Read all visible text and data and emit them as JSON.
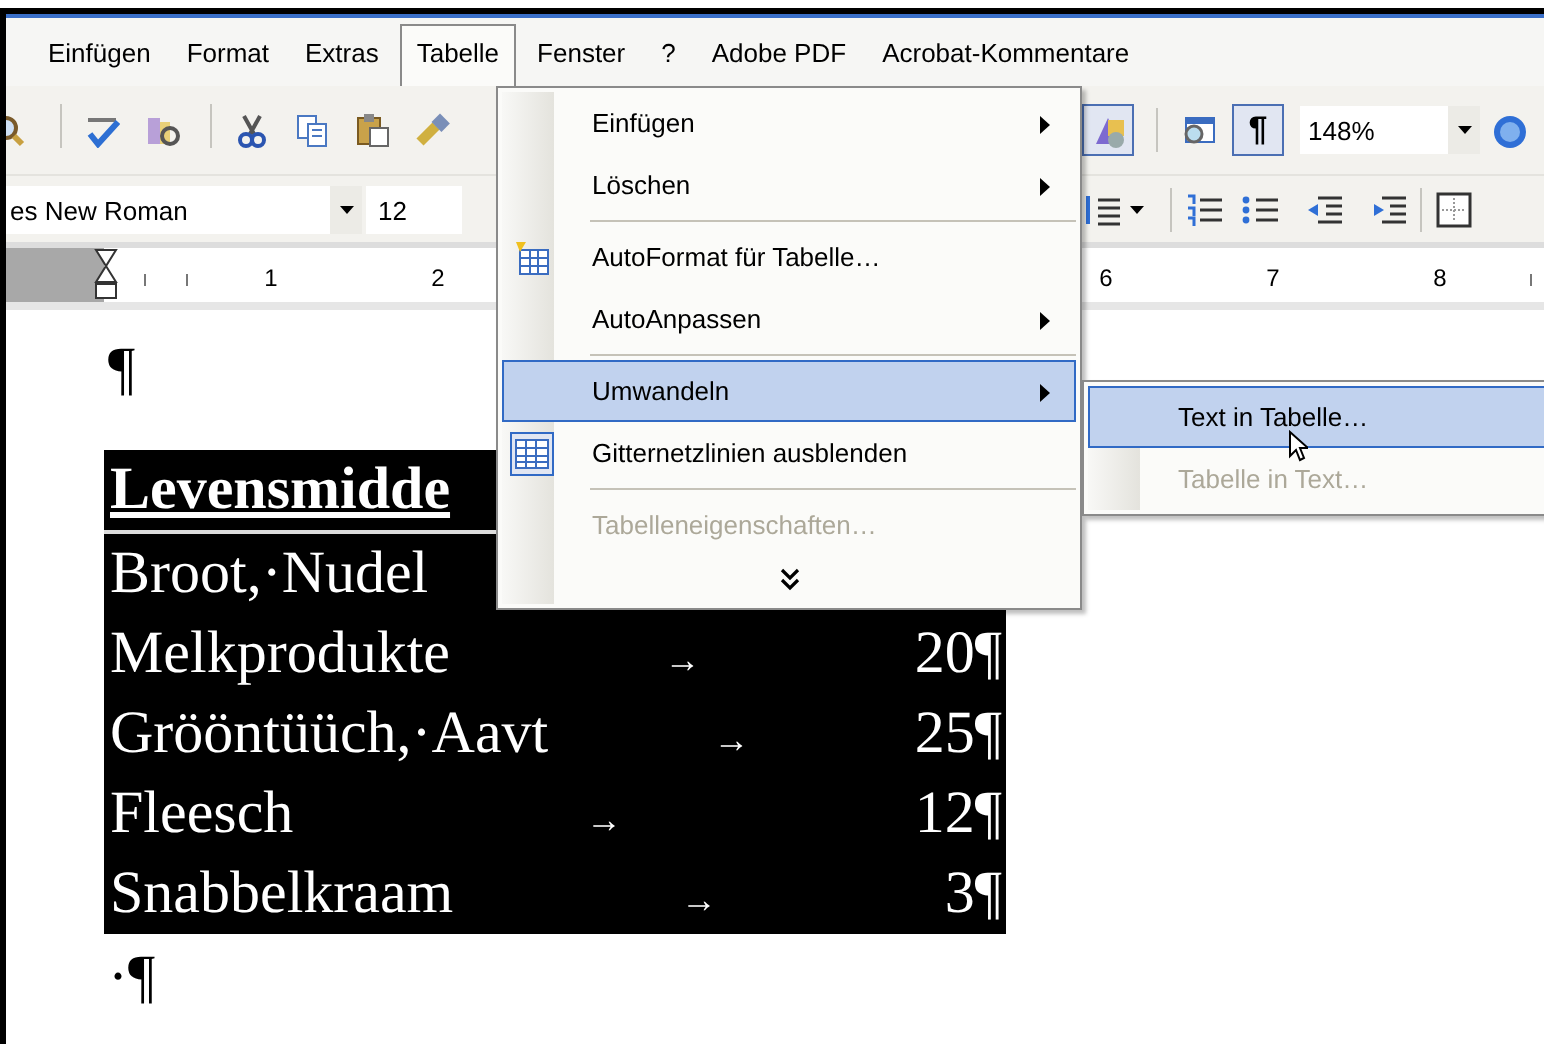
{
  "menubar": {
    "items": [
      {
        "label": "Einfügen",
        "selected": false
      },
      {
        "label": "Format",
        "selected": false
      },
      {
        "label": "Extras",
        "selected": false
      },
      {
        "label": "Tabelle",
        "selected": true
      },
      {
        "label": "Fenster",
        "selected": false
      },
      {
        "label": "?",
        "selected": false
      },
      {
        "label": "Adobe PDF",
        "selected": false
      },
      {
        "label": "Acrobat-Kommentare",
        "selected": false
      }
    ]
  },
  "standard_toolbar": {
    "left_buttons": [
      {
        "pressed": false
      },
      {
        "pressed": false
      },
      {
        "pressed": false
      },
      {
        "pressed": false
      },
      {
        "pressed": false
      },
      {
        "pressed": false
      },
      {
        "pressed": false
      }
    ],
    "right_buttons": [
      {
        "pressed": true
      },
      {
        "pressed": false
      },
      {
        "label": "¶",
        "pressed": true
      }
    ],
    "zoom": "148%"
  },
  "formatting_toolbar": {
    "font": "es New Roman",
    "size": "12"
  },
  "ruler": {
    "left_labels": [
      "1",
      "2"
    ],
    "right_labels": [
      "6",
      "7",
      "8"
    ]
  },
  "document": {
    "before": "¶",
    "rows": [
      {
        "kind": "heading",
        "text": "Levensmidde"
      },
      {
        "kind": "row",
        "text": "Broot,·Nudel"
      },
      {
        "kind": "row",
        "text": "Melkprodukte",
        "tab": "→",
        "value": "20¶"
      },
      {
        "kind": "row",
        "text": "Grööntüüch,·Aavt",
        "tab": "→",
        "value": "25¶"
      },
      {
        "kind": "row",
        "text": "Fleesch",
        "tab": "→",
        "value": "12¶"
      },
      {
        "kind": "row",
        "text": "Snabbelkraam",
        "tab": "→",
        "value": "3¶"
      }
    ],
    "after": "·¶"
  },
  "table_menu": {
    "items": [
      {
        "kind": "submenu",
        "label": "Einfügen",
        "selected": false,
        "disabled": false
      },
      {
        "kind": "submenu",
        "label": "Löschen",
        "selected": false,
        "disabled": false
      },
      {
        "kind": "separator"
      },
      {
        "kind": "command",
        "label": "AutoFormat für Tabelle…",
        "selected": false,
        "disabled": false
      },
      {
        "kind": "submenu",
        "label": "AutoAnpassen",
        "selected": false,
        "disabled": false
      },
      {
        "kind": "separator"
      },
      {
        "kind": "submenu",
        "label": "Umwandeln",
        "selected": true,
        "disabled": false
      },
      {
        "kind": "command",
        "label": "Gitternetzlinien ausblenden",
        "checked": true,
        "selected": false,
        "disabled": false
      },
      {
        "kind": "separator"
      },
      {
        "kind": "command",
        "label": "Tabelleneigenschaften…",
        "selected": false,
        "disabled": true
      },
      {
        "kind": "more"
      }
    ]
  },
  "convert_submenu": {
    "items": [
      {
        "kind": "command",
        "label": "Text in Tabelle…",
        "selected": true,
        "disabled": false
      },
      {
        "kind": "command",
        "label": "Tabelle in Text…",
        "selected": false,
        "disabled": true
      }
    ]
  }
}
